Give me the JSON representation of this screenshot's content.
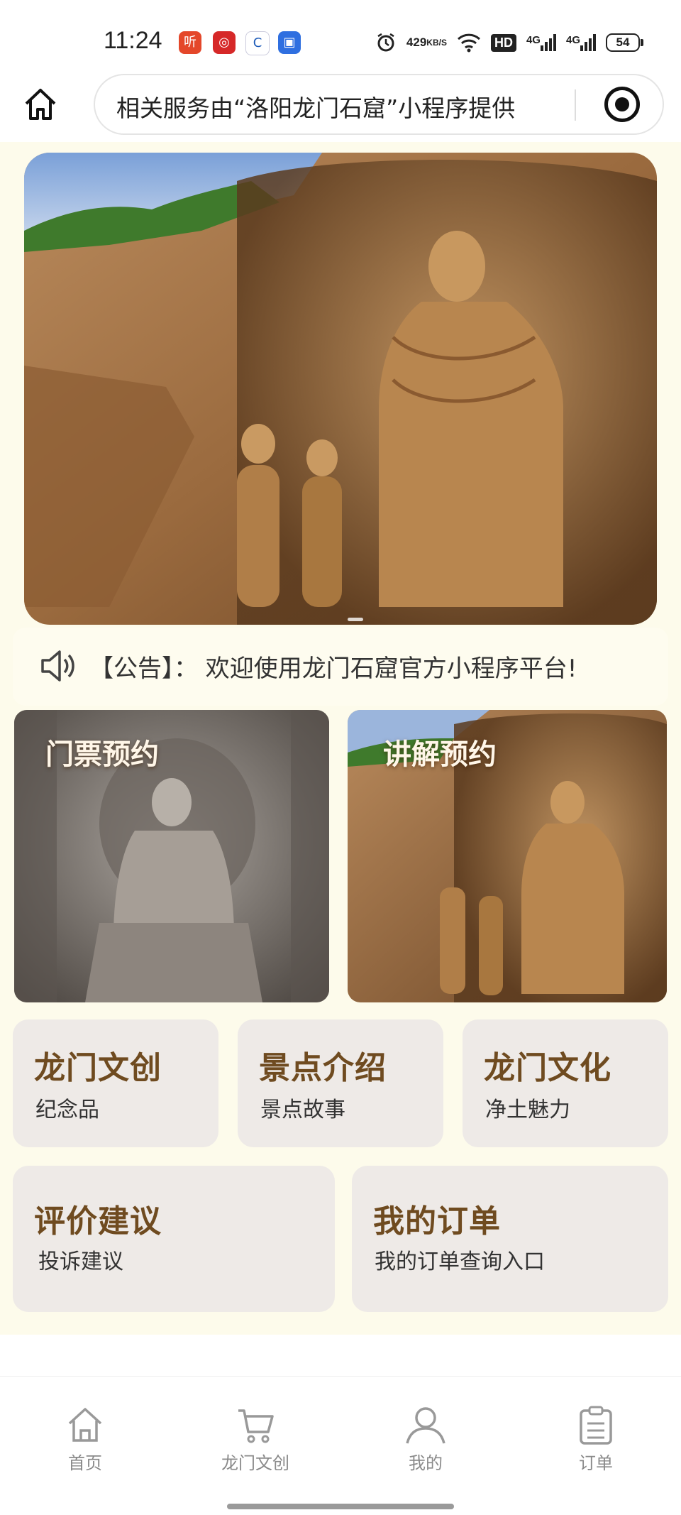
{
  "status_bar": {
    "time": "11:24",
    "net_speed_value": "429",
    "net_speed_unit": "KB/S",
    "hd_label": "HD",
    "signal_1": "4G",
    "signal_2": "4G",
    "battery": "54",
    "app_icons": [
      "listen-app-icon",
      "red-app-icon",
      "blue-c-app-icon",
      "blue-square-app-icon"
    ]
  },
  "nav": {
    "url_text": "相关服务由“洛阳龙门石窟”小程序提供"
  },
  "notice": {
    "text": "【公告】： 欢迎使用龙门石窟官方小程序平台!"
  },
  "features": {
    "ticket_label": "门票预约",
    "guide_label": "讲解预约"
  },
  "tiles": [
    {
      "title": "龙门文创",
      "subtitle": "纪念品"
    },
    {
      "title": "景点介绍",
      "subtitle": "景点故事"
    },
    {
      "title": "龙门文化",
      "subtitle": "净土魅力"
    },
    {
      "title": "评价建议",
      "subtitle": "投诉建议"
    },
    {
      "title": "我的订单",
      "subtitle": "我的订单查询入口"
    }
  ],
  "tabbar": [
    {
      "label": "首页",
      "icon": "home-icon"
    },
    {
      "label": "龙门文创",
      "icon": "cart-icon"
    },
    {
      "label": "我的",
      "icon": "user-icon"
    },
    {
      "label": "订单",
      "icon": "clipboard-icon"
    }
  ],
  "colors": {
    "page_background": "#fdfbeb",
    "tile_background": "#eeeae7",
    "tile_title": "#6f4b20",
    "tab_inactive": "#8a8a8a"
  }
}
